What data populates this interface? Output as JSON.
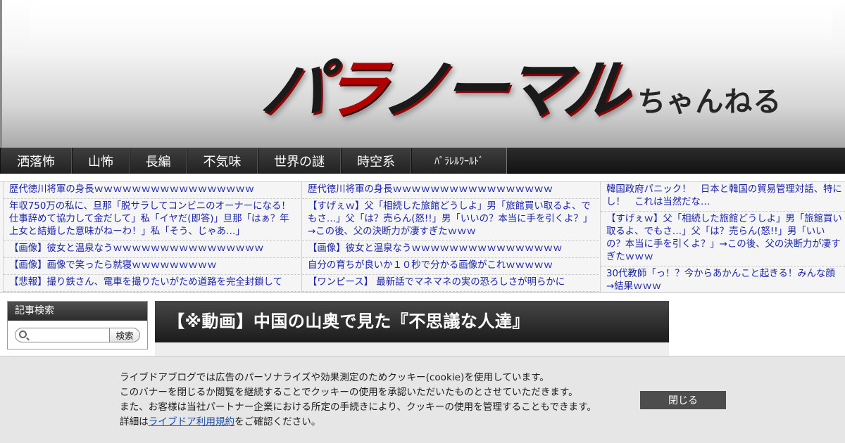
{
  "header": {
    "logo_main_a": "パ",
    "logo_main_b": "ラ",
    "logo_main_c": "ノーマル",
    "logo_sub": "ちゃんねる"
  },
  "nav": {
    "items": [
      "洒落怖",
      "山怖",
      "長編",
      "不気味",
      "世界の謎",
      "時空系",
      "ﾊﾟﾗﾚﾙﾜｰﾙﾄﾞ"
    ]
  },
  "rolls": {
    "col1": [
      "歴代徳川将軍の身長ｗｗｗｗｗｗｗｗｗｗｗｗｗｗｗｗｗ",
      "年収750万の私に、旦那「脱サラしてコンビニのオーナーになる！仕事辞めて協力して金だして」私「イヤだ(即答)」旦那「はぁ？年上女と結婚した意味がねーわ！」私「そう、じゃあ…」",
      "【画像】彼女と温泉なうｗｗｗｗｗｗｗｗｗｗｗｗｗｗｗｗ",
      "【画像】画像で笑ったら就寝ｗｗｗｗｗｗｗｗｗ",
      "【悲報】撮り鉄さん、電車を撮りたいがため道路を完全封鎖して"
    ],
    "col2": [
      "歴代徳川将軍の身長ｗｗｗｗｗｗｗｗｗｗｗｗｗｗｗｗｗ",
      "【すげぇｗ】父「相続した旅館どうしよ」男「旅館買い取るよ、でもさ…」父「は？売らん(怒!!」男「いいの？本当に手を引くよ？」→この後、父の決断力が凄すぎたｗｗｗ",
      "【画像】彼女と温泉なうｗｗｗｗｗｗｗｗｗｗｗｗｗｗｗｗ",
      "自分の育ちが良いか１０秒で分かる画像がこれｗｗｗｗｗ",
      "【ワンピース】 最新話でマネマネの実の恐ろしさが明らかに"
    ],
    "col3": [
      "韓国政府パニック！　日本と韓国の貿易管理対話、特にし！　これは当然だな…",
      "【すげぇｗ】父「相続した旅館どうしよ」男「旅館買い取るよ、でもさ…」父「は？売らん(怒!!」男「いいの？本当に手を引くよ？」→この後、父の決断力が凄すぎたｗｗｗ",
      "30代教師「っ！？今からあかんこと起きる！みんな顔→結果ｗｗｗ"
    ]
  },
  "sidebar": {
    "search_title": "記事検索",
    "search_button": "検索",
    "search_value": ""
  },
  "article": {
    "title": "【※動画】中国の山奥で見た『不思議な人達』"
  },
  "cookie": {
    "line1": "ライブドアブログでは広告のパーソナライズや効果測定のためクッキー(cookie)を使用しています。",
    "line2": "このバナーを閉じるか閲覧を継続することでクッキーの使用を承認いただいたものとさせていただきます。",
    "line3": "また、お客様は当社パートナー企業における所定の手続きにより、クッキーの使用を管理することもできます。",
    "line4_prefix": "詳細は",
    "line4_link": "ライブドア利用規約",
    "line4_suffix": "をご確認ください。",
    "close_label": "閉じる"
  }
}
